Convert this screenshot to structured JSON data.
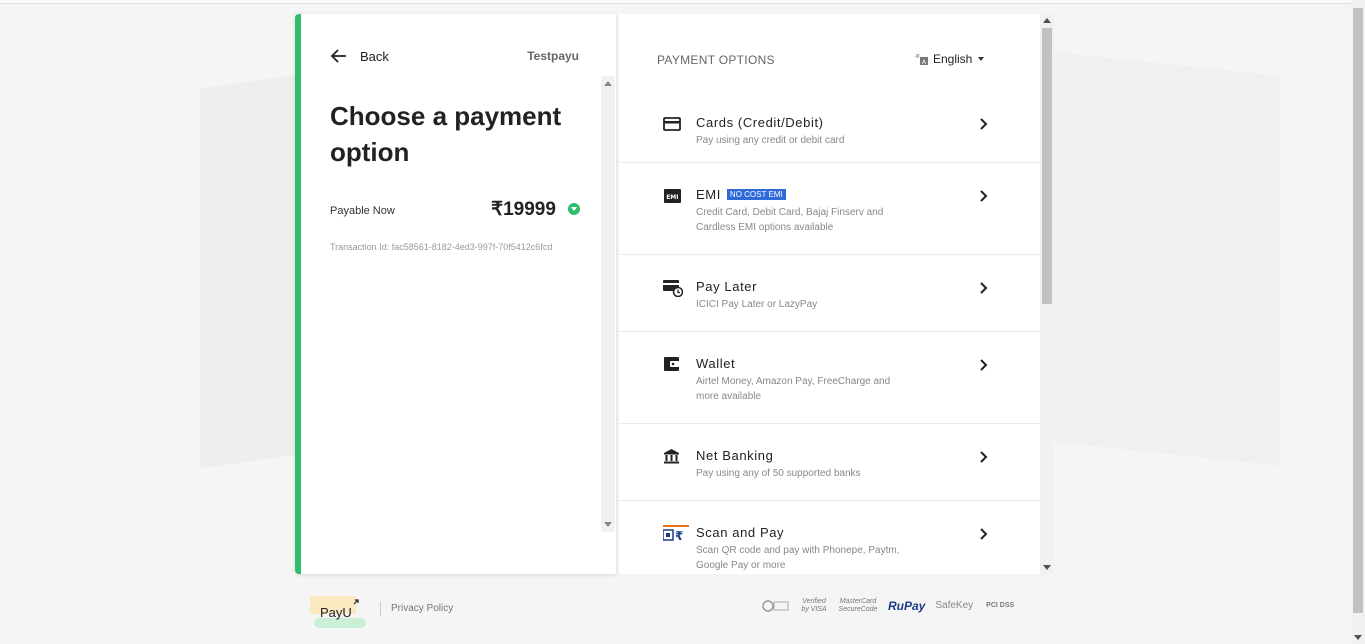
{
  "header": {
    "back_label": "Back",
    "merchant_name": "Testpayu",
    "heading": "Choose a payment option"
  },
  "payment": {
    "payable_label": "Payable Now",
    "amount": "₹19999",
    "transaction_id": "Transaction Id: fac58561-8182-4ed3-997f-70f5412c6fcd"
  },
  "options_panel": {
    "title": "PAYMENT OPTIONS",
    "language": "English",
    "options": [
      {
        "title": "Cards (Credit/Debit)",
        "desc": "Pay using any credit or debit card",
        "icon": "card-icon"
      },
      {
        "title": "EMI",
        "badge": "NO COST EMI",
        "desc": "Credit Card, Debit Card, Bajaj Finserv and Cardless EMI options available",
        "icon": "emi-icon"
      },
      {
        "title": "Pay Later",
        "desc": "ICICI Pay Later or LazyPay",
        "icon": "pay-later-icon"
      },
      {
        "title": "Wallet",
        "desc": "Airtel Money, Amazon Pay, FreeCharge and more available",
        "icon": "wallet-icon"
      },
      {
        "title": "Net Banking",
        "desc": "Pay using any of 50 supported banks",
        "icon": "bank-icon"
      },
      {
        "title": "Scan and Pay",
        "desc": "Scan QR code and pay with Phonepe, Paytm, Google Pay or more",
        "icon": "upi-qr-icon"
      }
    ]
  },
  "footer": {
    "logo_text": "PayU",
    "privacy_label": "Privacy Policy",
    "security_badges": [
      "Verified by VISA",
      "MasterCard SecureCode",
      "RuPay",
      "SafeKey",
      "PCI DSS"
    ]
  },
  "colors": {
    "accent": "#2dbf6e",
    "badge": "#2f6bd8"
  }
}
